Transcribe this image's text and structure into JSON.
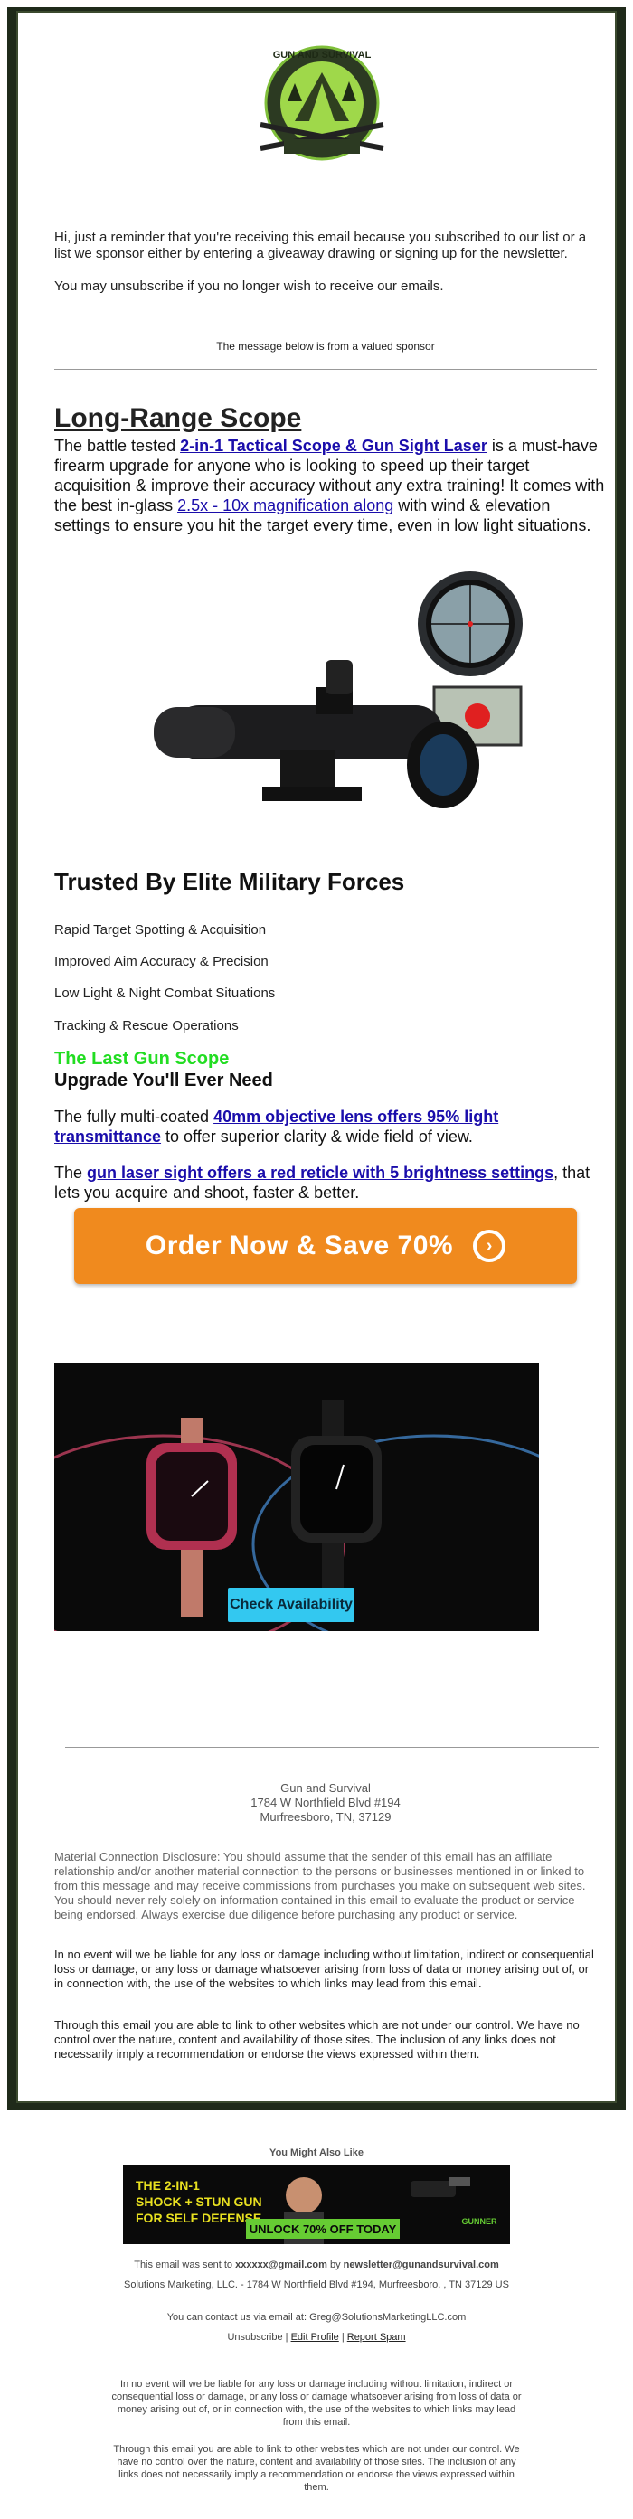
{
  "brand": {
    "name": "Gun and Survival",
    "logo_text": "GUN AND SURVIVAL",
    "colors": {
      "frame": "#1f2a1a",
      "link": "#1a0dab",
      "accent_green": "#22dd22",
      "cta_orange": "#f08a1e",
      "watch_button": "#33c8f0"
    }
  },
  "intro": {
    "reminder": "Hi, just a reminder that you're receiving this email because you subscribed to our list or a list we sponsor either by entering a giveaway drawing or signing up for the newsletter.",
    "unsubscribe_pre": "You may ",
    "unsubscribe_link": "unsubscribe",
    "unsubscribe_post": " if you no longer wish to receive our emails.",
    "sponsor_note": "The message below is from a valued sponsor"
  },
  "article": {
    "headline": "Long-Range Scope",
    "p1_a": "The battle tested ",
    "p1_link1": "2-in-1 Tactical Scope & Gun Sight Laser",
    "p1_b": " is a must-have firearm upgrade for anyone who is looking to speed up their target acquisition & improve their accuracy without any extra training! It comes with the best in-glass ",
    "p1_link2": "2.5x - 10x magnification along",
    "p1_c": " with wind & elevation settings to ensure you hit the target every time, even in low light situations.",
    "features_title": "Trusted By Elite Military Forces",
    "features": [
      "Rapid Target Spotting & Acquisition",
      "Improved Aim Accuracy & Precision",
      "Low Light & Night Combat Situations",
      "Tracking & Rescue Operations"
    ],
    "green_heading": "The Last Gun Scope",
    "black_heading": "Upgrade You'll Ever Need",
    "p2_a": "The fully multi-coated ",
    "p2_link": "40mm objective lens offers 95% light transmittance",
    "p2_b": " to offer superior clarity & wide field of view.",
    "p3_a": "The ",
    "p3_link": "gun laser sight offers a red reticle with 5 brightness settings",
    "p3_b": ", that lets you acquire and shoot, faster & better.",
    "cta_label": "Order Now & Save 70%",
    "cta_icon": "arrow-circle-icon"
  },
  "watch_ad": {
    "button_label": "Check Availability"
  },
  "address": {
    "name": "Gun and Survival",
    "line1": "1784 W Northfield Blvd #194",
    "line2": "Murfreesboro, TN, 37129"
  },
  "disclaimers": {
    "material": "Material Connection Disclosure: You should assume that the sender of this email has an affiliate relationship and/or another material connection to the persons or businesses mentioned in or linked to from this message and may receive commissions from purchases you make on subsequent web sites. You should never rely solely on information contained in this email to evaluate the product or service being endorsed. Always exercise due diligence before purchasing any product or service.",
    "liability": "In no event will we be liable for any loss or damage including without limitation, indirect or consequential loss or damage, or any loss or damage whatsoever arising from loss of data or money arising out of, or in connection with, the use of the websites to which links may lead from this email.",
    "links": "Through this email you are able to link to other websites which are not under our control. We have no control over the nature, content and availability of those sites. The inclusion of any links does not necessarily imply a recommendation or endorse the views expressed within them."
  },
  "you_might_like": {
    "title": "You Might Also Like",
    "ad_headline_l1": "THE 2-IN-1",
    "ad_headline_l2": "SHOCK + STUN GUN",
    "ad_headline_l3": "FOR SELF DEFENSE",
    "ad_button": "UNLOCK 70% OFF TODAY",
    "ad_brand": "GUNNER"
  },
  "footer": {
    "sent_to_pre": "This email was sent to ",
    "sent_to_email": "xxxxxx@gmail.com",
    "sent_by": " by ",
    "sender_email": "newsletter@gunandsurvival.com",
    "company_address": "Solutions Marketing, LLC. - 1784 W Northfield Blvd #194, Murfreesboro, , TN 37129 US",
    "contact": "You can contact us via email at: Greg@SolutionsMarketingLLC.com",
    "unsubscribe": "Unsubscribe",
    "sep": " | ",
    "edit_profile": "Edit Profile",
    "report_spam": "Report Spam",
    "liability": "In no event will we be liable for any loss or damage including without limitation, indirect or consequential loss or damage, or any loss or damage whatsoever arising from loss of data or money arising out of, or in connection with, the use of the websites to which links may lead from this email.",
    "links": "Through this email you are able to link to other websites which are not under our control. We have no control over the nature, content and availability of those sites. The inclusion of any links does not necessarily imply a recommendation or endorse the views expressed within them."
  }
}
